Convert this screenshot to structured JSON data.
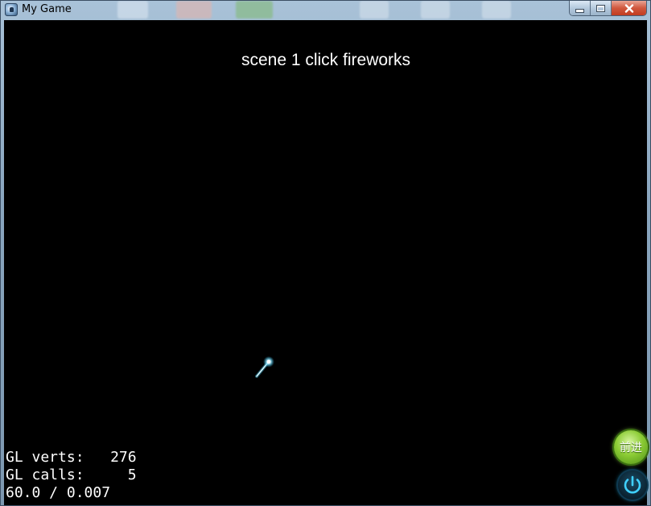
{
  "window": {
    "title": "My Game",
    "controls": {
      "minimize": "minimize-icon",
      "maximize": "maximize-icon",
      "close": "close-icon"
    }
  },
  "game": {
    "scene_title": "scene 1 click fireworks",
    "stats": {
      "verts_label": "GL verts:",
      "verts_value": "276",
      "calls_label": "GL calls:",
      "calls_value": "5",
      "fps_line": "60.0 / 0.007"
    },
    "next_button_label": "前进",
    "power_button_icon": "power-icon"
  },
  "colors": {
    "background": "#000000",
    "text": "#ffffff",
    "next_button": "#8ccc35",
    "power_glow": "#1aa7d6",
    "firework": "#bff4ff"
  }
}
